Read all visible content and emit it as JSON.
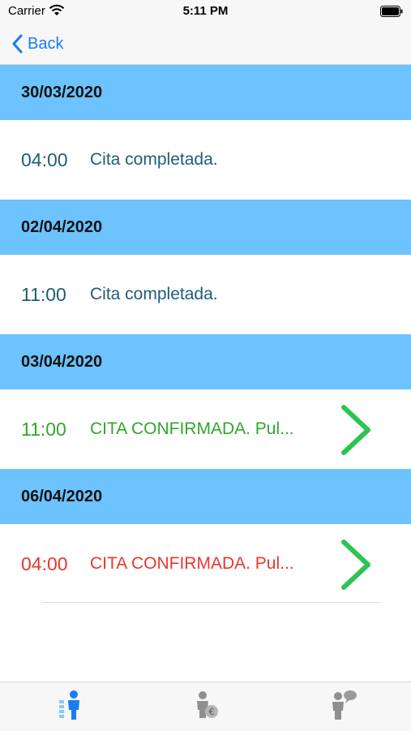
{
  "status_bar": {
    "carrier": "Carrier",
    "time": "5:11 PM"
  },
  "nav": {
    "back_label": "Back"
  },
  "colors": {
    "header_bg": "#6cc3fd",
    "completed": "#1f5c78",
    "confirmed_green": "#2fa82a",
    "confirmed_red": "#e5382f",
    "chevron_green": "#2ec352",
    "nav_blue": "#1a7cf2"
  },
  "appointments": [
    {
      "date": "30/03/2020",
      "time": "04:00",
      "status": "Cita completada."
    },
    {
      "date": "02/04/2020",
      "time": "11:00",
      "status": "Cita completada."
    },
    {
      "date": "03/04/2020",
      "time": "11:00",
      "status": "CITA CONFIRMADA. Pul..."
    },
    {
      "date": "06/04/2020",
      "time": "04:00",
      "status": "CITA CONFIRMADA. Pul..."
    }
  ],
  "tabs": [
    {
      "icon": "person-blue-icon"
    },
    {
      "icon": "person-euro-icon"
    },
    {
      "icon": "person-speech-icon"
    }
  ]
}
